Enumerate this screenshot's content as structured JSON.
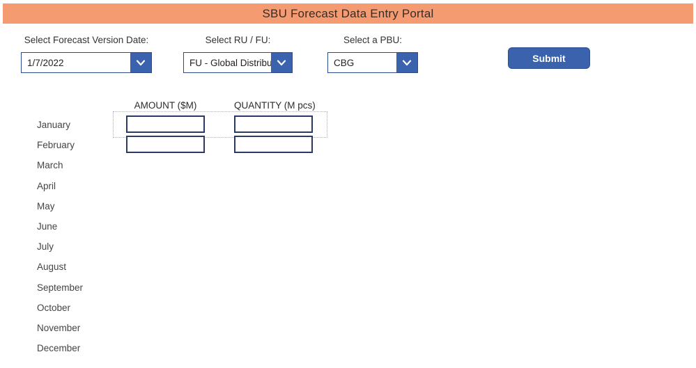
{
  "header": {
    "title": "SBU Forecast Data Entry Portal",
    "background_color": "#f59b72"
  },
  "filters": {
    "version": {
      "label": "Select Forecast Version Date:",
      "value": "1/7/2022",
      "arrow_icon": "chevron-down-icon"
    },
    "ru_fu": {
      "label": "Select RU / FU:",
      "value": "FU - Global Distribution",
      "arrow_icon": "chevron-down-icon"
    },
    "pbu": {
      "label": "Select a PBU:",
      "value": "CBG",
      "arrow_icon": "chevron-down-icon"
    }
  },
  "toolbar": {
    "submit_label": "Submit",
    "submit_color": "#3b63ad"
  },
  "grid": {
    "columns": [
      {
        "key": "amount",
        "label": "AMOUNT ($M)"
      },
      {
        "key": "quantity",
        "label": "QUANTITY (M pcs)"
      }
    ],
    "rows": [
      {
        "month": "January",
        "amount": "",
        "quantity": ""
      },
      {
        "month": "February",
        "amount": "",
        "quantity": ""
      },
      {
        "month": "March",
        "amount": "",
        "quantity": ""
      },
      {
        "month": "April",
        "amount": "",
        "quantity": ""
      },
      {
        "month": "May",
        "amount": "",
        "quantity": ""
      },
      {
        "month": "June",
        "amount": "",
        "quantity": ""
      },
      {
        "month": "July",
        "amount": "",
        "quantity": ""
      },
      {
        "month": "August",
        "amount": "",
        "quantity": ""
      },
      {
        "month": "September",
        "amount": "",
        "quantity": ""
      },
      {
        "month": "October",
        "amount": "",
        "quantity": ""
      },
      {
        "month": "November",
        "amount": "",
        "quantity": ""
      },
      {
        "month": "December",
        "amount": "",
        "quantity": ""
      }
    ],
    "input_rows_visible": 2
  }
}
